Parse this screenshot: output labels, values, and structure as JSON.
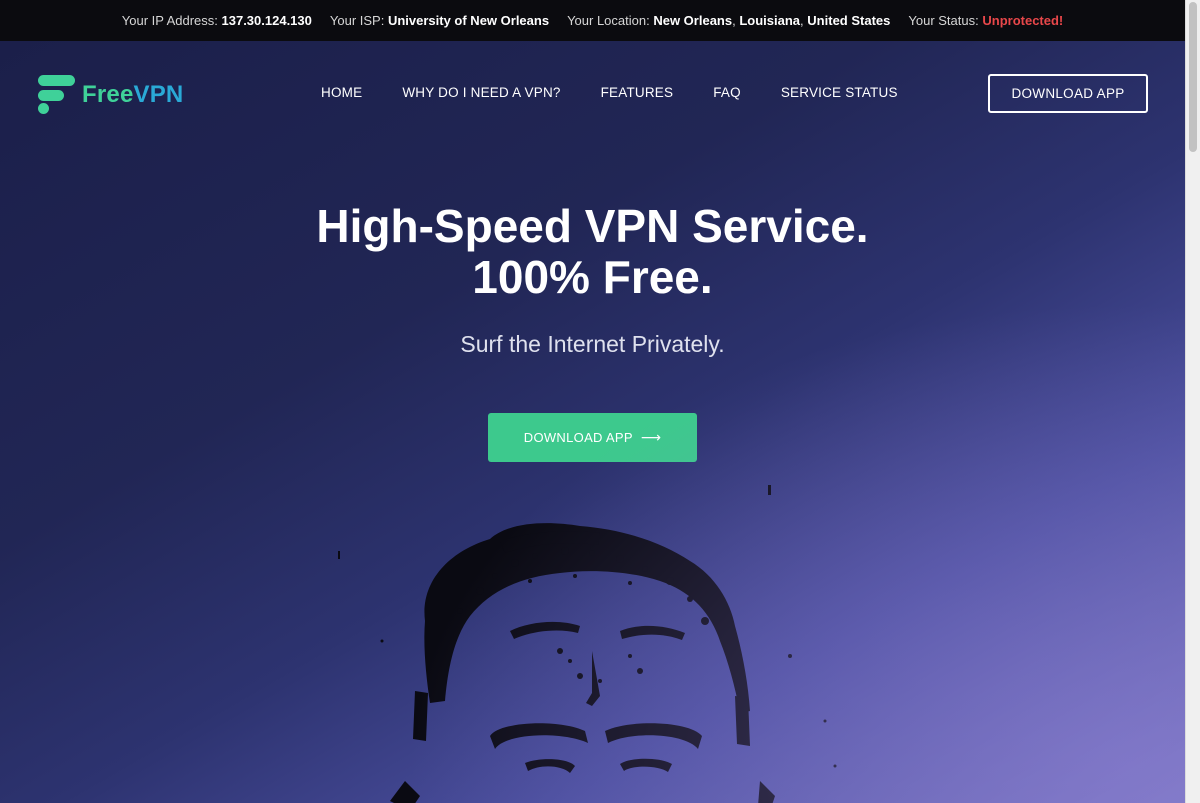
{
  "topbar": {
    "ip_label": "Your IP Address:",
    "ip_value": "137.30.124.130",
    "isp_label": "Your ISP:",
    "isp_value": "University of New Orleans",
    "location_label": "Your Location:",
    "location_city": "New Orleans",
    "location_state": "Louisiana",
    "location_country": "United States",
    "status_label": "Your Status:",
    "status_value": "Unprotected!"
  },
  "brand": {
    "name_part1": "Free",
    "name_part2": "VPN",
    "color_green": "#3fd199",
    "color_blue": "#2aa9d6"
  },
  "nav": {
    "items": [
      {
        "label": "HOME"
      },
      {
        "label": "WHY DO I NEED A VPN?"
      },
      {
        "label": "FEATURES"
      },
      {
        "label": "FAQ"
      },
      {
        "label": "SERVICE STATUS"
      }
    ],
    "download_label": "DOWNLOAD APP"
  },
  "hero": {
    "title_line1": "High-Speed VPN Service.",
    "title_line2": "100% Free.",
    "subtitle": "Surf the Internet Privately.",
    "cta_label": "DOWNLOAD APP",
    "cta_icon": "arrow-right-icon",
    "cta_color": "#3dc98d"
  }
}
